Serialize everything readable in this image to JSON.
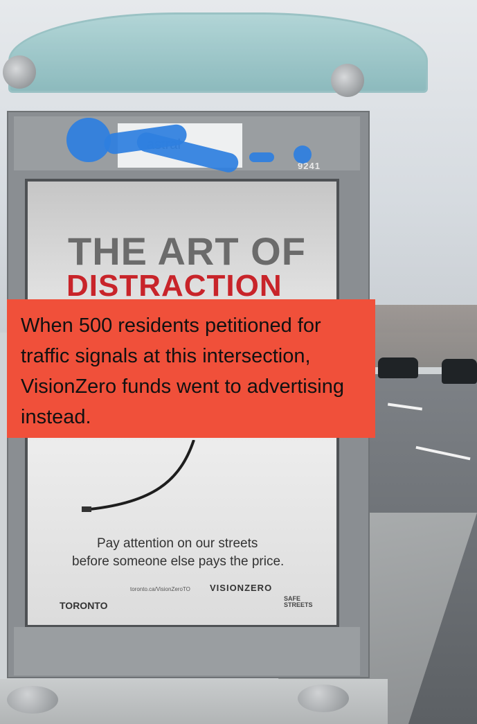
{
  "image": {
    "poster": {
      "headline_line1": "THE ART OF",
      "headline_line2": "DISTRACTION",
      "tagline_line1": "Pay attention on our streets",
      "tagline_line2": "before someone else pays the price.",
      "url": "toronto.ca/VisionZeroTO",
      "vision_zero_logo": "VISIONZERO",
      "toronto_logo": "TORONTO",
      "safe_streets_logo": "SAFE STREETS"
    },
    "shelter": {
      "ad_company_logo": "astral",
      "shelter_number": "9241"
    },
    "callout": {
      "text": "When 500 residents petitioned for traffic signals at this intersection, VisionZero funds went to advertising instead."
    },
    "colors": {
      "callout_background": "#f0503a",
      "graffiti_blue": "#2e7fe0",
      "headline_red": "#c8242a"
    }
  }
}
